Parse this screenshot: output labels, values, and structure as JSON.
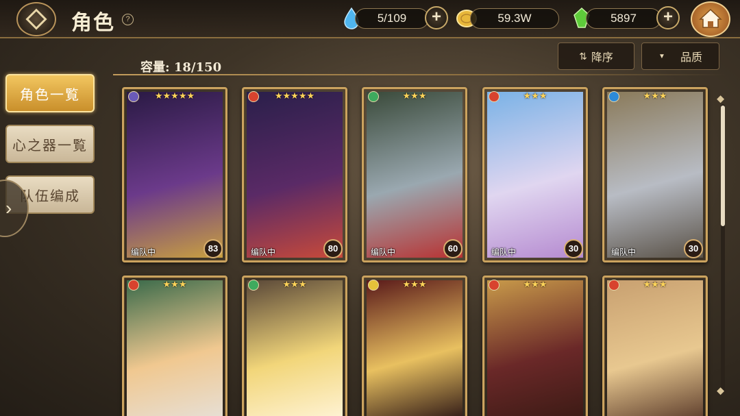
{
  "header": {
    "title": "角色",
    "help_label": "?"
  },
  "resources": [
    {
      "icon": "water-drop-icon",
      "value": "5/109"
    },
    {
      "icon": "gold-coin-icon",
      "value": "59.3W"
    },
    {
      "icon": "green-crystal-icon",
      "value": "5897"
    }
  ],
  "sidebar": {
    "items": [
      {
        "label": "角色一覧",
        "active": true
      },
      {
        "label": "心之器一覧",
        "active": false
      },
      {
        "label": "队伍编成",
        "active": false
      }
    ]
  },
  "main": {
    "capacity": "容量: 18/150",
    "sort_label": "降序",
    "filter_label": "品质"
  },
  "cards": [
    {
      "stars": "★★★★★",
      "status": "编队中",
      "level": "83",
      "element": "dark",
      "colors": [
        "#2a1a44",
        "#6b3a8a",
        "#c9a040"
      ]
    },
    {
      "stars": "★★★★★",
      "status": "编队中",
      "level": "80",
      "element": "fire",
      "colors": [
        "#2a1f4a",
        "#5a2a66",
        "#c84a3a"
      ]
    },
    {
      "stars": "★★★",
      "status": "编队中",
      "level": "60",
      "element": "wind",
      "colors": [
        "#3a4a3a",
        "#9aa8b0",
        "#b83232"
      ]
    },
    {
      "stars": "★★★",
      "status": "编队中",
      "level": "30",
      "element": "fire",
      "colors": [
        "#7ab2e6",
        "#e0d6f0",
        "#b58ad0"
      ]
    },
    {
      "stars": "★★★",
      "status": "编队中",
      "level": "30",
      "element": "water",
      "colors": [
        "#8a7a5a",
        "#b8bcc4",
        "#5a5248"
      ]
    },
    {
      "stars": "★★★",
      "element": "fire",
      "colors": [
        "#3a6a4a",
        "#f0c890",
        "#e6e0d8"
      ]
    },
    {
      "stars": "★★★",
      "element": "wind",
      "colors": [
        "#5a4838",
        "#f2d67a",
        "#fff4d8"
      ]
    },
    {
      "stars": "★★★",
      "element": "light",
      "colors": [
        "#5a1a1a",
        "#e8c060",
        "#2a1414"
      ]
    },
    {
      "stars": "★★★",
      "element": "fire",
      "colors": [
        "#c89a4a",
        "#6a2828",
        "#3a1a14"
      ]
    },
    {
      "stars": "★★★",
      "element": "fire",
      "colors": [
        "#c8a070",
        "#e8c890",
        "#5a3a2a"
      ]
    }
  ],
  "colors": {
    "accent_gold": "#cba35f",
    "active_tab": "#f2c660",
    "level_badge": "#2b1c14"
  }
}
